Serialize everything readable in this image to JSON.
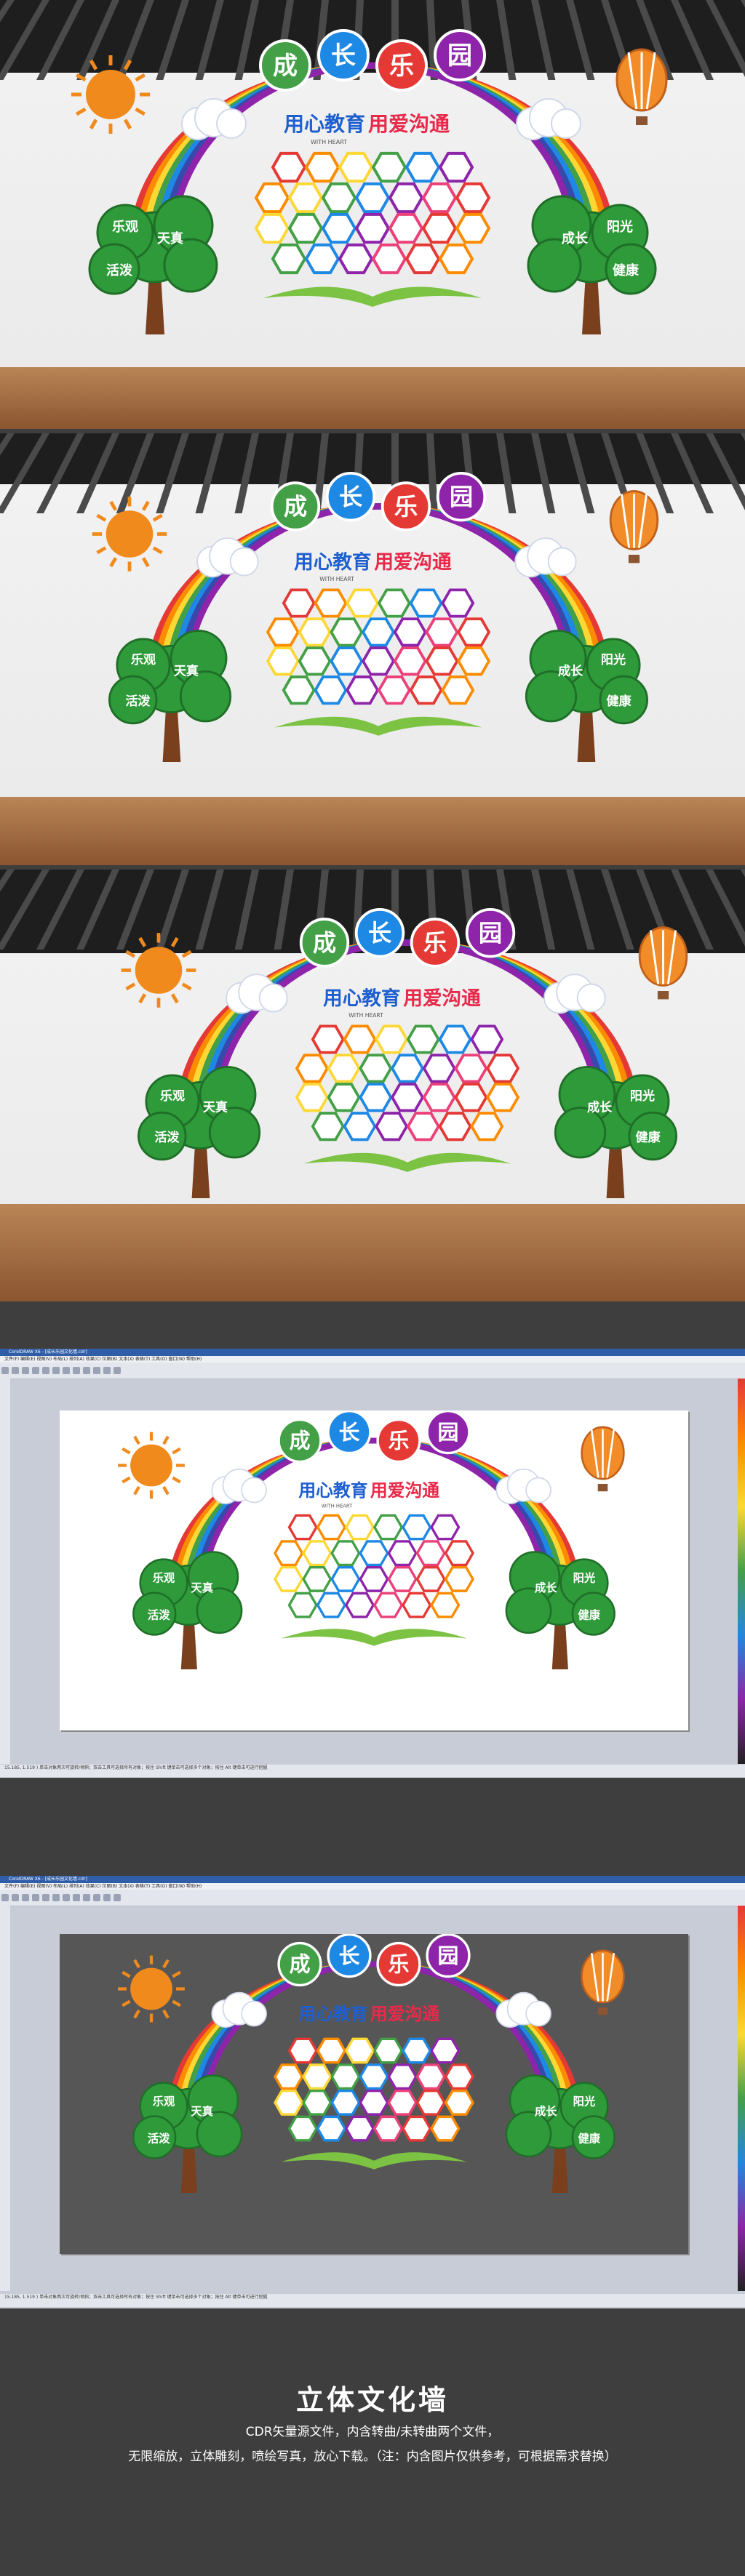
{
  "mural": {
    "balloon_chars": [
      "成",
      "长",
      "乐",
      "园"
    ],
    "slogan_a": "用心教育",
    "slogan_b": "用爱沟通",
    "slogan_small": "WITH HEART",
    "leaves": [
      "乐观",
      "天真",
      "活泼",
      "阳光",
      "成长",
      "健康"
    ],
    "colors": {
      "rainbow": [
        "#e53935",
        "#fb8c00",
        "#fdd835",
        "#43a047",
        "#1e88e5",
        "#3949ab",
        "#8e24aa"
      ],
      "tree": "#2e9a3a",
      "trunk": "#7a3f1d",
      "sun": "#f08a1c"
    }
  },
  "software": {
    "title": "CorelDRAW X6 - [成长乐园文化墙.cdr]",
    "menu": "文件(F)  编辑(E)  视图(V)  布局(L)  排列(A)  效果(C)  位图(B)  文本(X)  表格(T)  工具(O)  窗口(W)  帮助(H)",
    "status": "15.185, 1.519 )   单击对象两次可旋转/倾斜；双击工具可选择所有对象；按住 Shift 键单击可选择多个对象；按住 Alt 键单击可进行挖掘"
  },
  "footer": {
    "title": "立体文化墙",
    "line1": "CDR矢量源文件，内含转曲/未转曲两个文件，",
    "line2": "无限缩放，立体雕刻，喷绘写真，放心下载。（注：内含图片仅供参考，可根据需求替换）"
  }
}
